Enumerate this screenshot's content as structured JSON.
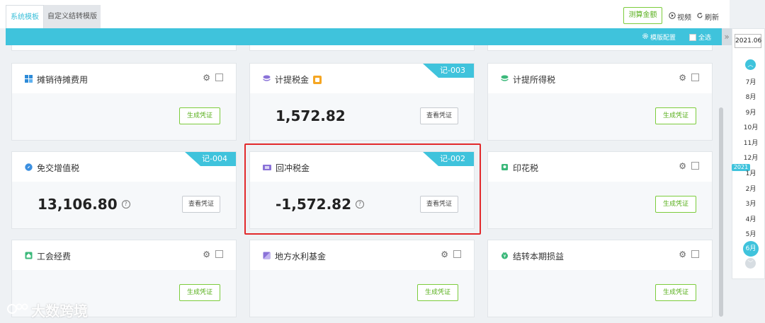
{
  "tabs": [
    {
      "label": "系统模板",
      "active": true
    },
    {
      "label": "自定义结转模版",
      "active": false
    }
  ],
  "toolbar": {
    "calc_label": "测算金额",
    "video_label": "视频",
    "refresh_label": "刷新"
  },
  "bar": {
    "config_label": "模版配置",
    "select_all_label": "全选"
  },
  "cards": [
    {
      "title": "摊销待摊费用",
      "icon": "grid-icon",
      "button": "生成凭证"
    },
    {
      "title": "计提税金",
      "icon": "layers-icon",
      "badge": "tax-badge-icon",
      "amount": "1,572.82",
      "button": "查看凭证",
      "ribbon": "记-003"
    },
    {
      "title": "计提所得税",
      "icon": "layers-green-icon",
      "button": "生成凭证"
    },
    {
      "title": "免交增值税",
      "icon": "compass-icon",
      "amount": "13,106.80",
      "button": "查看凭证",
      "ribbon": "记-004"
    },
    {
      "title": "回冲税金",
      "icon": "ticket-icon",
      "amount": "-1,572.82",
      "button": "查看凭证",
      "ribbon": "记-002"
    },
    {
      "title": "印花税",
      "icon": "stamp-icon",
      "button": "生成凭证"
    },
    {
      "title": "工会经费",
      "icon": "union-icon",
      "button": "生成凭证"
    },
    {
      "title": "地方水利基金",
      "icon": "water-fund-icon",
      "button": "生成凭证"
    },
    {
      "title": "结转本期损益",
      "icon": "profit-icon",
      "button": "生成凭证"
    }
  ],
  "months_panel": {
    "year_value": "2021.06",
    "year_tag": "2021",
    "months": [
      "7月",
      "8月",
      "9月",
      "10月",
      "11月",
      "12月",
      "1月",
      "2月",
      "3月",
      "4月",
      "5月",
      "6月"
    ],
    "selected": "6月"
  },
  "watermark": "大数跨境"
}
